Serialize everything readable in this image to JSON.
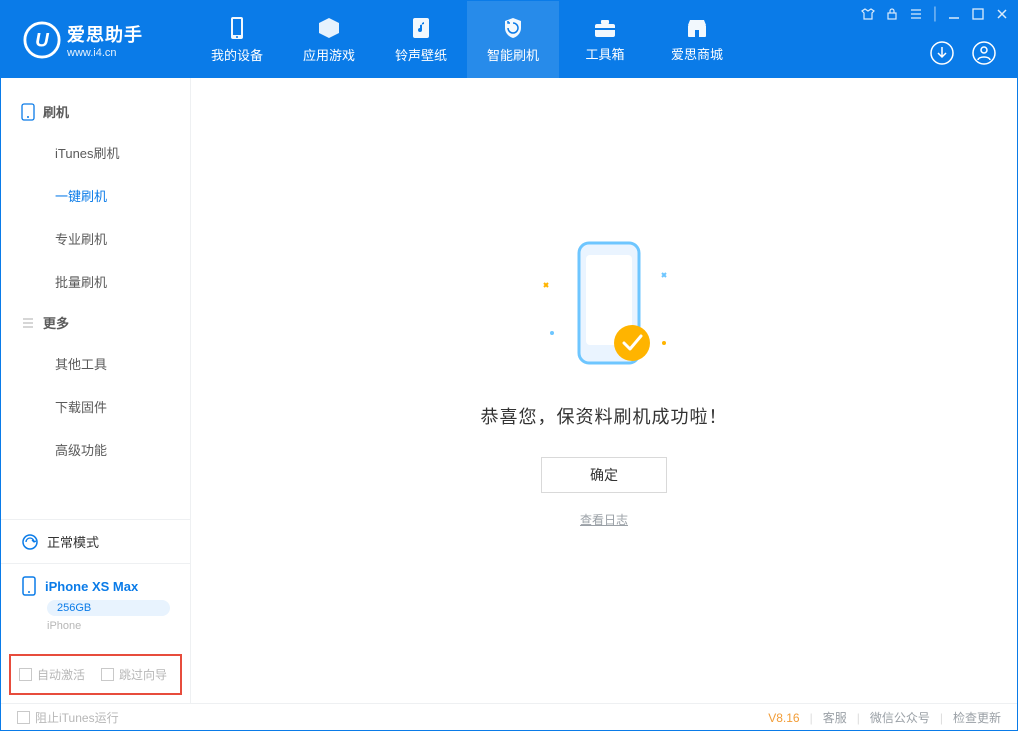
{
  "app": {
    "name": "爱思助手",
    "url": "www.i4.cn"
  },
  "nav": {
    "items": [
      {
        "label": "我的设备"
      },
      {
        "label": "应用游戏"
      },
      {
        "label": "铃声壁纸"
      },
      {
        "label": "智能刷机"
      },
      {
        "label": "工具箱"
      },
      {
        "label": "爱思商城"
      }
    ],
    "active_index": 3
  },
  "sidebar": {
    "group1": {
      "title": "刷机",
      "items": [
        "iTunes刷机",
        "一键刷机",
        "专业刷机",
        "批量刷机"
      ],
      "selected_index": 1
    },
    "group2": {
      "title": "更多",
      "items": [
        "其他工具",
        "下载固件",
        "高级功能"
      ]
    },
    "mode_label": "正常模式",
    "device": {
      "name": "iPhone XS Max",
      "storage": "256GB",
      "type": "iPhone"
    },
    "checkboxes": {
      "auto_activate": "自动激活",
      "skip_guide": "跳过向导"
    }
  },
  "main": {
    "success_text": "恭喜您，保资料刷机成功啦！",
    "ok_button": "确定",
    "view_log": "查看日志"
  },
  "footer": {
    "block_itunes": "阻止iTunes运行",
    "version": "V8.16",
    "links": [
      "客服",
      "微信公众号",
      "检查更新"
    ]
  }
}
